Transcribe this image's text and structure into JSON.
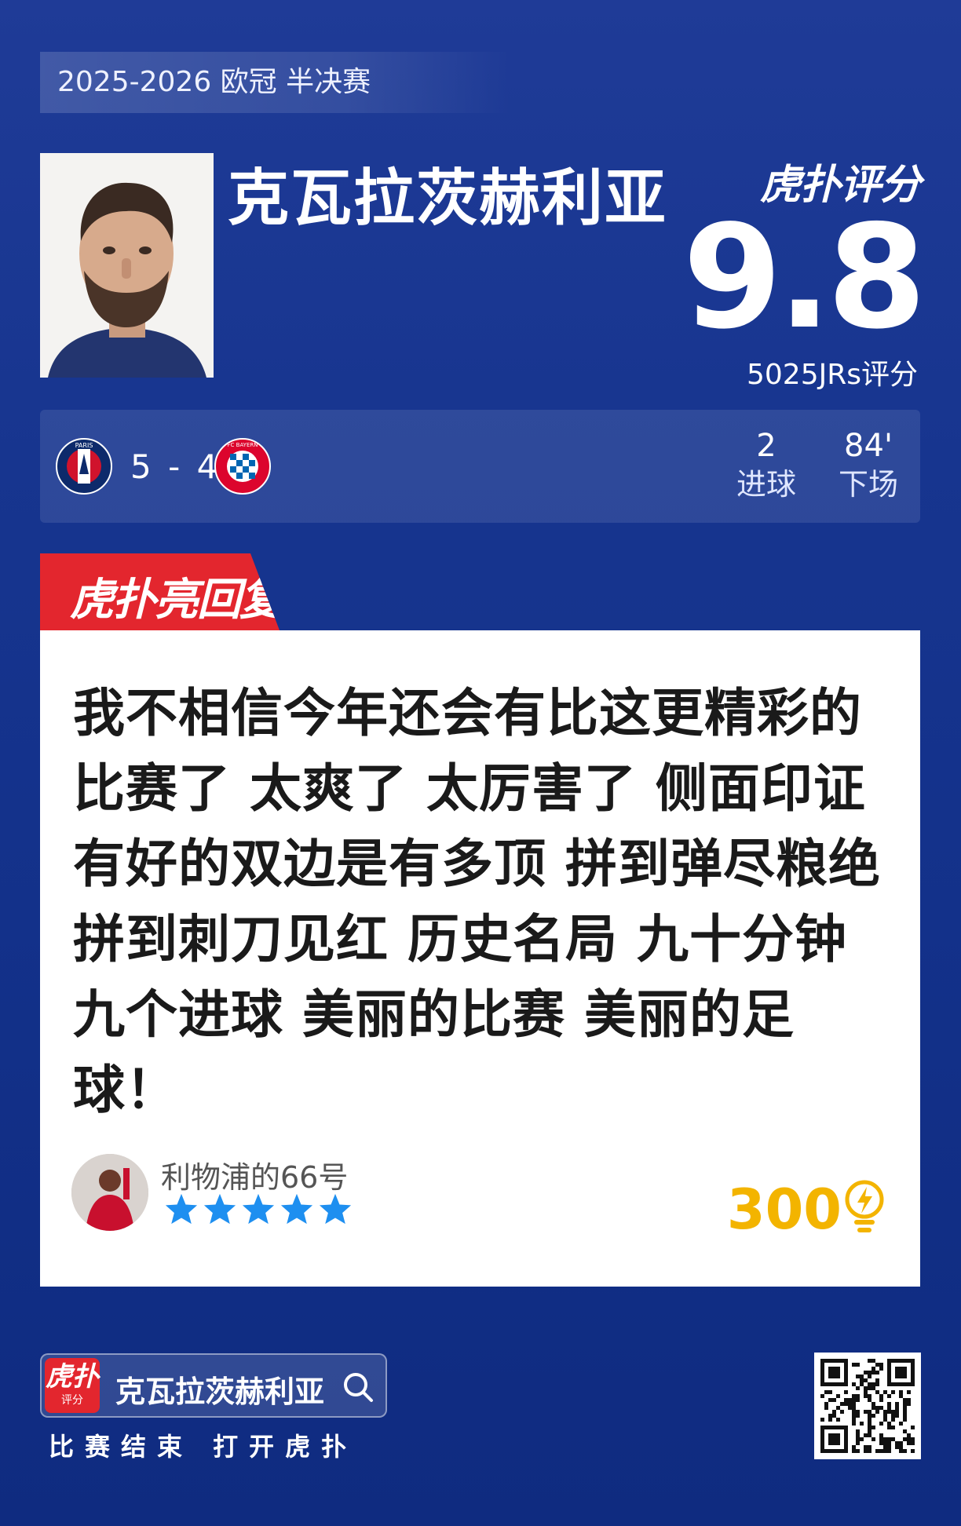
{
  "header": {
    "season": "2025-2026 欧冠 半决赛",
    "player_name": "克瓦拉茨赫利亚",
    "rating_brand": "虎扑评分",
    "score": "9.8",
    "raters": "5025JRs评分"
  },
  "match": {
    "home_logo": "psg-crest-icon",
    "home_logo_text": "PARIS",
    "score": "5 - 4",
    "away_logo": "fc-bayern-crest-icon",
    "away_logo_text": "FC BAYERN",
    "stats": [
      {
        "value": "2",
        "label": "进球"
      },
      {
        "value": "84'",
        "label": "下场"
      }
    ]
  },
  "review": {
    "tag": "虎扑亮回复",
    "comment": "我不相信今年还会有比这更精彩的比赛了 太爽了 太厉害了 侧面印证有好的双边是有多顶 拼到弹尽粮绝拼到刺刀见红 历史名局 九十分钟九个进球 美丽的比赛 美丽的足球！",
    "user": "利物浦的66号",
    "stars": 5,
    "likes": "300"
  },
  "footer": {
    "logo_big": "虎扑",
    "logo_small": "评分",
    "search_text": "克瓦拉茨赫利亚",
    "tagline": "比赛结束 打开虎扑"
  },
  "colors": {
    "background": "#17358f",
    "accent_red": "#e3262e",
    "star_blue": "#1e8ff0",
    "likes_gold": "#f3b400"
  }
}
